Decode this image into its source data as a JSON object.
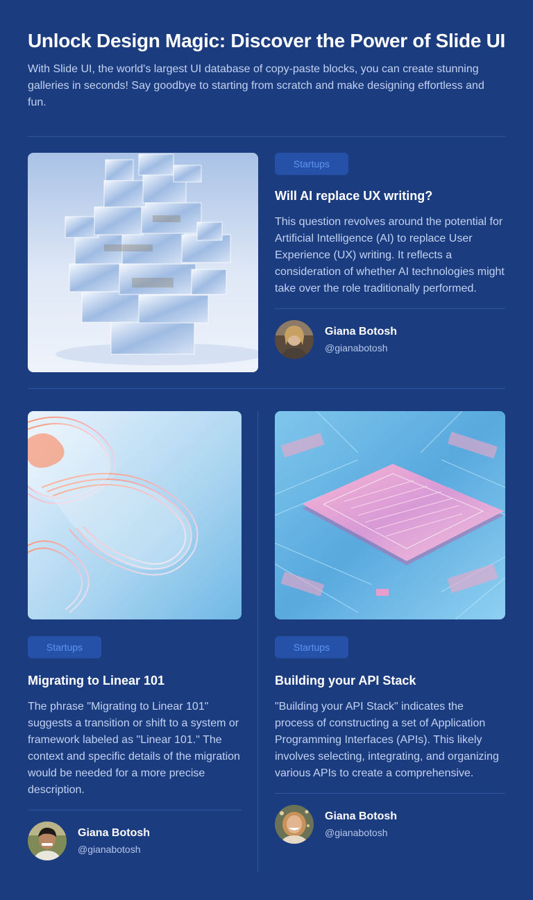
{
  "header": {
    "title": "Unlock Design Magic: Discover the Power of Slide UI",
    "subtitle": "With Slide UI, the world's largest UI database of copy-paste blocks, you can create stunning galleries in seconds! Say goodbye to starting from scratch and make designing effortless and fun."
  },
  "posts": [
    {
      "tag": "Startups",
      "title": "Will AI replace UX writing?",
      "text": "This question revolves around the potential for Artificial Intelligence (AI) to replace User Experience (UX) writing. It reflects a consideration of whether AI technologies might take over the role traditionally performed.",
      "author": {
        "name": "Giana Botosh",
        "handle": "@gianabotosh"
      }
    },
    {
      "tag": "Startups",
      "title": "Migrating to Linear 101",
      "text": "The phrase \"Migrating to Linear 101\" suggests a transition or shift to a system or framework labeled as \"Linear 101.\" The context and specific details of the migration would be needed for a more precise description.",
      "author": {
        "name": "Giana Botosh",
        "handle": "@gianabotosh"
      }
    },
    {
      "tag": "Startups",
      "title": "Building your API Stack",
      "text": "\"Building your API Stack\" indicates the process of constructing a set of Application Programming Interfaces (APIs). This likely involves selecting, integrating, and organizing various APIs to create a comprehensive.",
      "author": {
        "name": "Giana Botosh",
        "handle": "@gianabotosh"
      }
    }
  ],
  "colors": {
    "background": "#1b3c7f",
    "tag_bg": "#2552a8",
    "tag_text": "#5d94ef",
    "divider": "#2f569f"
  }
}
